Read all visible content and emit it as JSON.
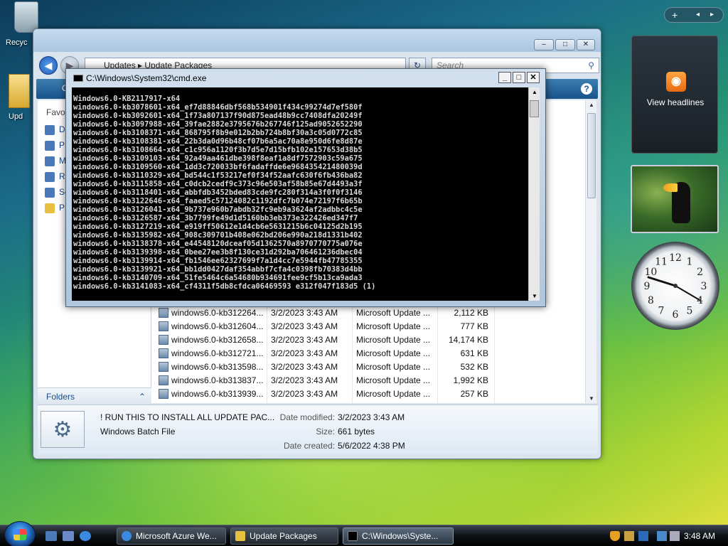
{
  "desktop": {
    "recycle_label": "Recyc",
    "folder_label": "Upd"
  },
  "explorer": {
    "address_crumbs": "Updates  ▸  Update Packages",
    "search_placeholder": "Search",
    "toolbar_first": "O",
    "favorites_label": "Favo",
    "nav_links": [
      "D",
      "P",
      "M",
      "R",
      "Se",
      "P"
    ],
    "folders_label": "Folders",
    "files": [
      {
        "name": "windows6.0-kb312264...",
        "date": "3/2/2023 3:43 AM",
        "type": "Microsoft Update ...",
        "size": "2,112 KB"
      },
      {
        "name": "windows6.0-kb312604...",
        "date": "3/2/2023 3:43 AM",
        "type": "Microsoft Update ...",
        "size": "777 KB"
      },
      {
        "name": "windows6.0-kb312658...",
        "date": "3/2/2023 3:43 AM",
        "type": "Microsoft Update ...",
        "size": "14,174 KB"
      },
      {
        "name": "windows6.0-kb312721...",
        "date": "3/2/2023 3:43 AM",
        "type": "Microsoft Update ...",
        "size": "631 KB"
      },
      {
        "name": "windows6.0-kb313598...",
        "date": "3/2/2023 3:43 AM",
        "type": "Microsoft Update ...",
        "size": "532 KB"
      },
      {
        "name": "windows6.0-kb313837...",
        "date": "3/2/2023 3:43 AM",
        "type": "Microsoft Update ...",
        "size": "1,992 KB"
      },
      {
        "name": "windows6.0-kb313939...",
        "date": "3/2/2023 3:43 AM",
        "type": "Microsoft Update ...",
        "size": "257 KB"
      }
    ],
    "details": {
      "name": "! RUN THIS TO INSTALL ALL UPDATE PAC...",
      "type": "Windows Batch File",
      "modified_label": "Date modified:",
      "modified_value": "3/2/2023 3:43 AM",
      "size_label": "Size:",
      "size_value": "661 bytes",
      "created_label": "Date created:",
      "created_value": "5/6/2022 4:38 PM"
    }
  },
  "cmd": {
    "title": "C:\\Windows\\System32\\cmd.exe",
    "lines": [
      "Windows6.0-KB2117917-x64",
      "windows6.0-kb3078601-x64_ef7d88846dbf568b534901f434c99274d7ef580f",
      "windows6.0-kb3092601-x64_1f73a807137f90d875ead48b9cc7408dfa20249f",
      "windows6.0-kb3097988-x64_39fae2882e3795676b267746f125ad9052652290",
      "windows6.0-kb3108371-x64_868795f8b9e012b2bb724b8bf30a3c05d0772c85",
      "windows6.0-kb3108381-x64_22b3da0d96b48cf07b6a5ac70a8e950d6fe8d87e",
      "windows6.0-kb3108664-x64_c1c956a1120f3b7d5e7d15bfb102e157653d38b5",
      "windows6.0-kb3109103-x64_92a49aa461dbe398f8eaf1a8df7572903c59a675",
      "windows6.0-kb3109560-x64_1dd3c720033bf6fadaffde6e968435421480039d",
      "windows6.0-kb3110329-x64_bd544c1f53217ef0f34f52aafc630f6fb436ba82",
      "windows6.0-kb3115858-x64_c0dcb2cedf9c373c96e503af58b85e67d4493a3f",
      "windows6.0-kb3118401-x64_abbfdb3452bded83cde9fc280f314a3f0f0f3146",
      "windows6.0-kb3122646-x64_faaed5c57124082c1192dfc7b074e72197f6b65b",
      "windows6.0-kb3126041-x64_9b737e960b7abdb32fc9eb9a3624af2adbbc4c5e",
      "windows6.0-kb3126587-x64_3b7799fe49d1d5160bb3eb373e322426ed347f7",
      "windows6.0-kb3127219-x64_e919ff50612e1d4cb6e5631215b6c04125d2b195",
      "windows6.0-kb3135982-x64_908c309701b408e062bd206e990a218d1331b402",
      "windows6.0-kb3138378-x64_e44548120dceaf05d1362570a8970770775a076e",
      "windows6.0-kb3139398-x64_0bee27ee3b8f130ce31d292ba706461236dbec04",
      "windows6.0-kb3139914-x64_fb1546ee62327699f7a1d4cc7e5944fb47785355",
      "windows6.0-kb3139921-x64_bb1dd0427daf354abbf7cfa4c0398fb70383d4bb",
      "windows6.0-kb3140709-x64_51fe5464c6a54680b934691fee9cf5b13ca9ada3",
      "windows6.0-kb3141083-x64_cf4311f5db8cfdca06469593 e312f047f183d5 (1)"
    ]
  },
  "gadgets": {
    "feed_text": "View headlines",
    "feed_icon": "rss-icon",
    "clock_numbers": [
      "12",
      "1",
      "2",
      "3",
      "4",
      "5",
      "6",
      "7",
      "8",
      "9",
      "10",
      "11"
    ]
  },
  "taskbar": {
    "tasks": [
      "Microsoft Azure We...",
      "Update Packages",
      "C:\\Windows\\Syste..."
    ],
    "time": "3:48 AM"
  }
}
